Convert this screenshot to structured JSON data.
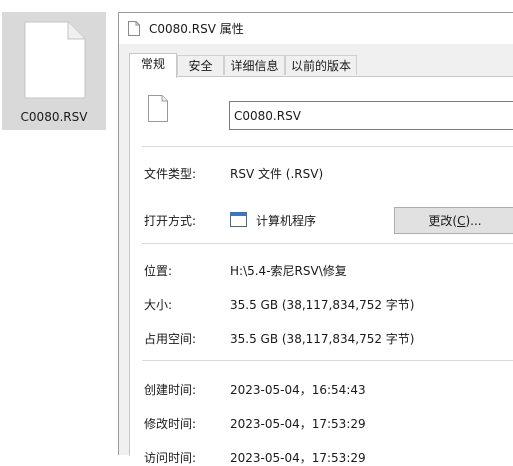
{
  "desktop": {
    "file_label": "C0080.RSV"
  },
  "dialog": {
    "title": "C0080.RSV 属性",
    "tabs": [
      "常规",
      "安全",
      "详细信息",
      "以前的版本"
    ],
    "file_name": "C0080.RSV",
    "rows": {
      "type_label": "文件类型:",
      "type_value": "RSV 文件 (.RSV)",
      "open_label": "打开方式:",
      "open_app": "计算机程序",
      "location_label": "位置:",
      "location_value": "H:\\5.4-索尼RSV\\修复",
      "size_label": "大小:",
      "size_value": "35.5 GB (38,117,834,752 字节)",
      "disk_label": "占用空间:",
      "disk_value": "35.5 GB (38,117,834,752 字节)",
      "created_label": "创建时间:",
      "created_value": "2023-05-04，16:54:43",
      "modified_label": "修改时间:",
      "modified_value": "2023-05-04，17:53:29",
      "accessed_label": "访问时间:",
      "accessed_value": "2023-05-04，17:53:29"
    },
    "change_button": {
      "prefix": "更改(",
      "mnemonic": "C",
      "suffix": ")..."
    }
  }
}
